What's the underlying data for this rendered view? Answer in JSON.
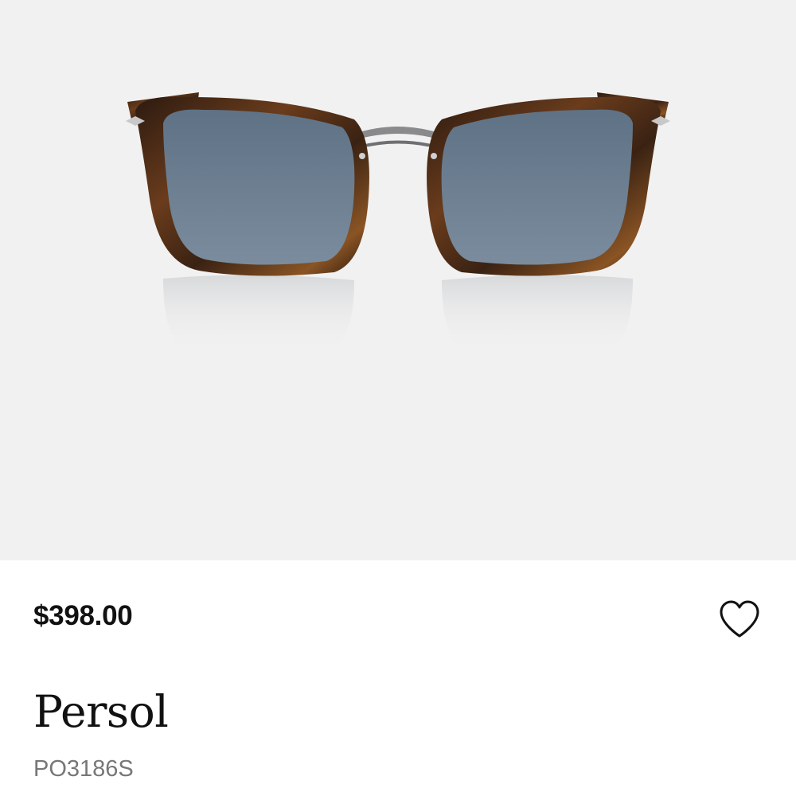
{
  "product": {
    "price": "$398.00",
    "brand": "Persol",
    "model": "PO3186S",
    "favorite_icon": "heart-outline-icon",
    "image_alt": "Persol PO3186S sunglasses, tortoise frame with blue lenses"
  },
  "colors": {
    "image_background": "#f1f1f1",
    "text_primary": "#111111",
    "text_secondary": "#777777",
    "frame_tortoise": "#3b2416",
    "lens": "#6b7e90"
  }
}
